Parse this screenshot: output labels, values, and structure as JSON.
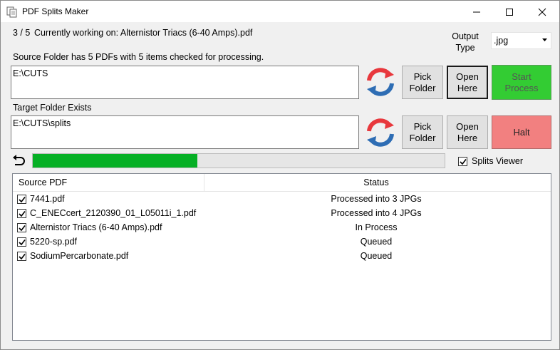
{
  "window": {
    "title": "PDF Splits Maker"
  },
  "status_line": {
    "counter": "3 / 5",
    "working_label": "Currently working on: Alternistor Triacs (6-40 Amps).pdf"
  },
  "output_type": {
    "label_line1": "Output",
    "label_line2": "Type",
    "selected": ".jpg"
  },
  "source": {
    "status_text": "Source Folder has 5 PDFs with 5 items checked for processing.",
    "path": "E:\\CUTS",
    "pick_line1": "Pick",
    "pick_line2": "Folder",
    "open_line1": "Open",
    "open_line2": "Here",
    "start_line1": "Start",
    "start_line2": "Process"
  },
  "target": {
    "status_text": "Target Folder Exists",
    "path": "E:\\CUTS\\splits",
    "pick_line1": "Pick",
    "pick_line2": "Folder",
    "open_line1": "Open",
    "open_line2": "Here",
    "halt_label": "Halt"
  },
  "progress": {
    "fraction": 0.4
  },
  "splits_viewer": {
    "label": "Splits Viewer",
    "checked": true
  },
  "list": {
    "columns": [
      "Source PDF",
      "Status"
    ],
    "rows": [
      {
        "file": "7441.pdf",
        "status": "Processed into 3 JPGs",
        "checked": true
      },
      {
        "file": "C_ENECcert_2120390_01_L05011i_1.pdf",
        "status": "Processed into 4 JPGs",
        "checked": true
      },
      {
        "file": "Alternistor Triacs (6-40 Amps).pdf",
        "status": "In Process",
        "checked": true
      },
      {
        "file": "5220-sp.pdf",
        "status": "Queued",
        "checked": true
      },
      {
        "file": "SodiumPercarbonate.pdf",
        "status": "Queued",
        "checked": true
      }
    ]
  },
  "colors": {
    "start_button": "#33cc33",
    "halt_button": "#f28080",
    "progress_fill": "#06b025",
    "refresh_red": "#e8383d",
    "refresh_blue": "#2e6db4"
  },
  "icons": {
    "app": "pdf-pages-icon",
    "refresh": "sync-arrows-icon",
    "back": "undo-arrow-icon"
  }
}
